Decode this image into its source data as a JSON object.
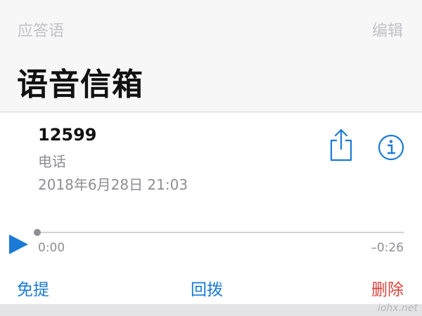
{
  "nav": {
    "left_label": "应答语",
    "right_label": "编辑"
  },
  "page_title": "语音信箱",
  "voicemail": {
    "number": "12599",
    "label": "电话",
    "datetime": "2018年6月28日 21:03"
  },
  "player": {
    "elapsed": "0:00",
    "remaining": "–0:26",
    "progress": 0
  },
  "actions": {
    "speaker": "免提",
    "callback": "回拨",
    "delete": "删除"
  },
  "watermark": "iohx.net",
  "icons": {
    "share": "share-icon",
    "info": "info-icon",
    "play": "play-icon"
  },
  "colors": {
    "accent": "#1a7ad6",
    "destructive": "#d9453c",
    "secondary_text": "#8e8e93"
  }
}
